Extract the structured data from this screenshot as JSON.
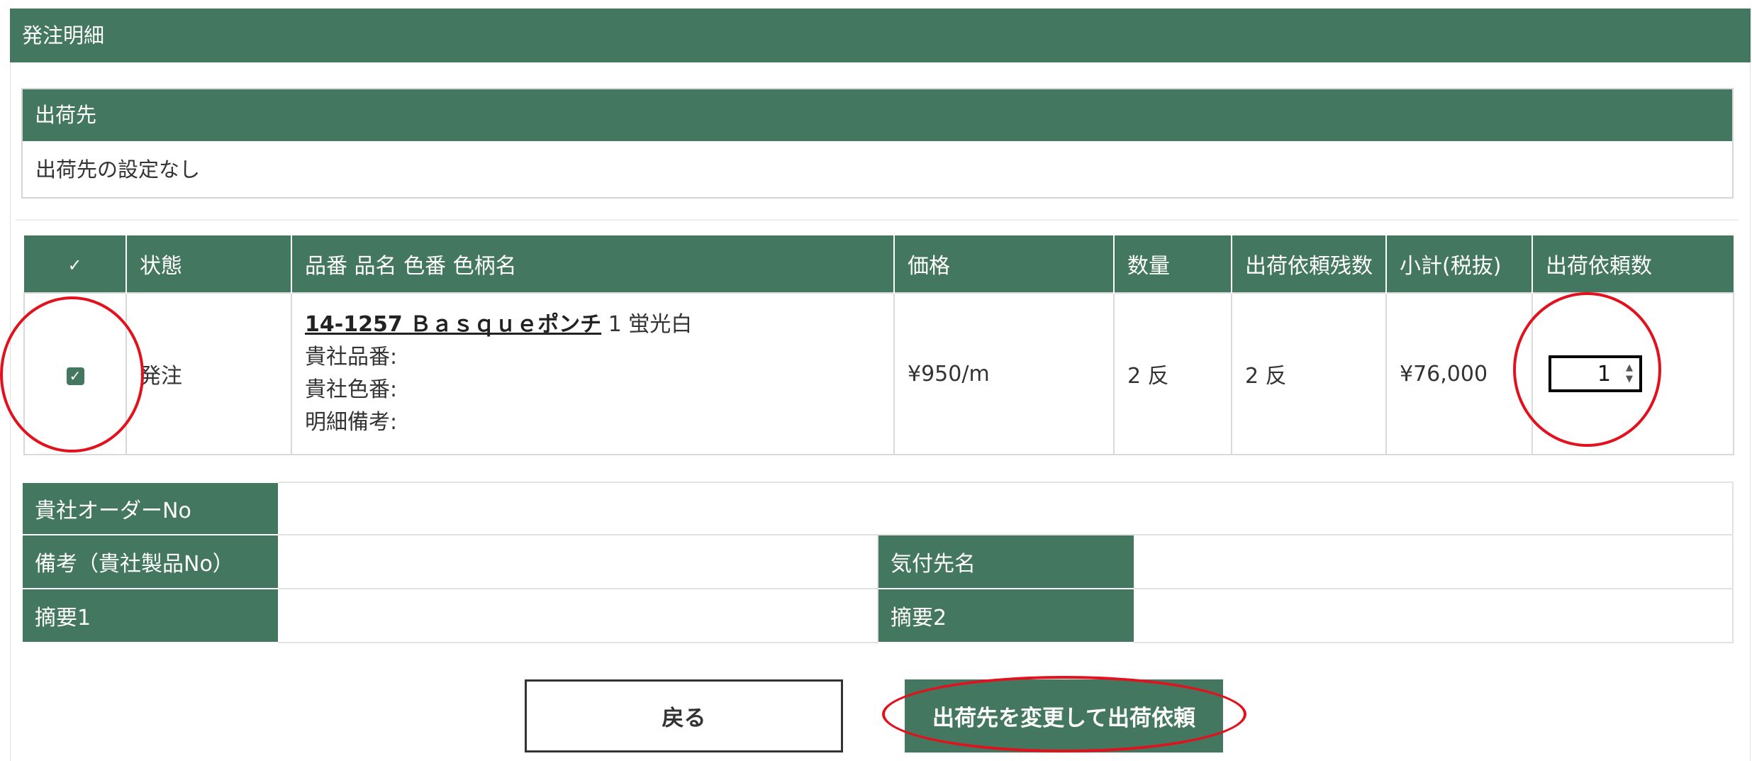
{
  "section_title": "発注明細",
  "shipping": {
    "header": "出荷先",
    "value": "出荷先の設定なし"
  },
  "table": {
    "headers": {
      "check": "✓",
      "status": "状態",
      "product": "品番 品名 色番 色柄名",
      "price": "価格",
      "quantity": "数量",
      "remaining": "出荷依頼残数",
      "subtotal": "小計(税抜)",
      "request_qty": "出荷依頼数"
    },
    "row": {
      "checked": true,
      "check_glyph": "✓",
      "status": "発注",
      "product_link": "14-1257 Ｂａｓｑｕｅポンチ",
      "color_no_name": "1 蛍光白",
      "client_part_no": "貴社品番:",
      "client_color_no": "貴社色番:",
      "line_note": "明細備考:",
      "price": "¥950/m",
      "quantity": "2 反",
      "remaining": "2 反",
      "subtotal": "¥76,000",
      "request_qty": "1",
      "stepper_up": "▲",
      "stepper_down": "▼"
    }
  },
  "info": {
    "order_no_label": "貴社オーダーNo",
    "order_no_value": "",
    "remarks_label": "備考（貴社製品No）",
    "remarks_value": "",
    "attention_label": "気付先名",
    "attention_value": "",
    "summary1_label": "摘要1",
    "summary1_value": "",
    "summary2_label": "摘要2",
    "summary2_value": ""
  },
  "buttons": {
    "back": "戻る",
    "change_and_request": "出荷先を変更して出荷依頼"
  },
  "colors": {
    "brand_green": "#44775f",
    "annotation_red": "#e3101d"
  }
}
